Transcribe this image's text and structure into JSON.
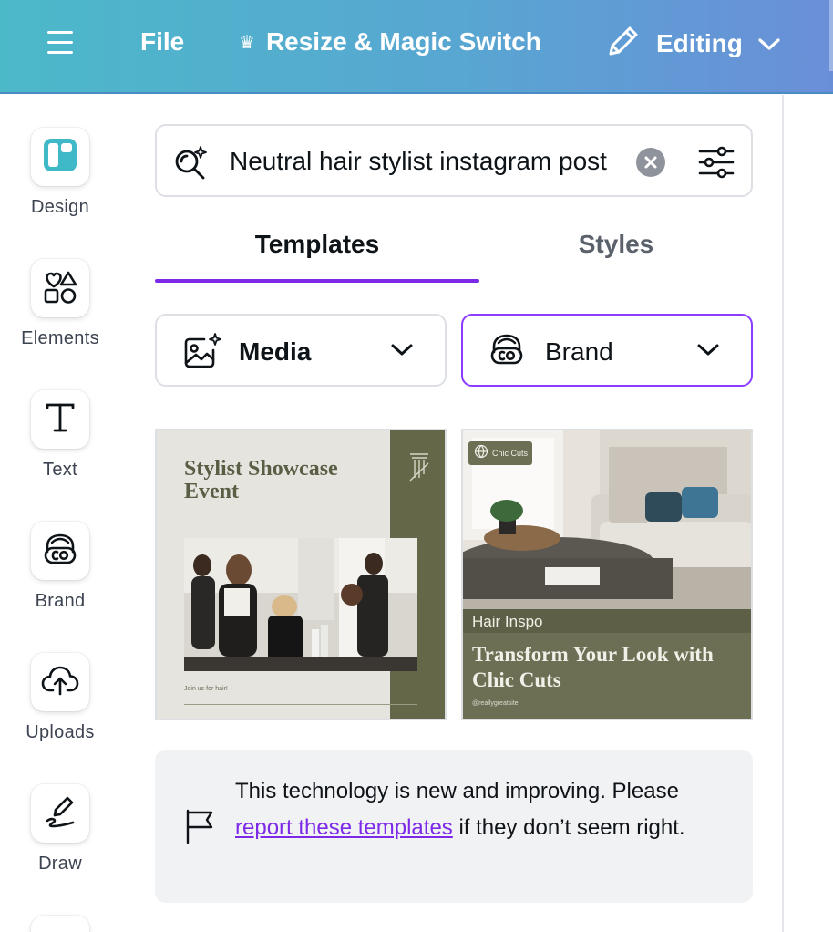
{
  "topbar": {
    "file_label": "File",
    "resize_label": "Resize & Magic Switch",
    "editing_label": "Editing"
  },
  "rail": {
    "items": [
      {
        "label": "Design",
        "icon": "design-icon"
      },
      {
        "label": "Elements",
        "icon": "elements-icon"
      },
      {
        "label": "Text",
        "icon": "text-icon"
      },
      {
        "label": "Brand",
        "icon": "brand-icon"
      },
      {
        "label": "Uploads",
        "icon": "upload-cloud-icon"
      },
      {
        "label": "Draw",
        "icon": "draw-icon"
      }
    ]
  },
  "search": {
    "value": "Neutral hair stylist instagram post"
  },
  "tabs": [
    {
      "label": "Templates",
      "active": true
    },
    {
      "label": "Styles",
      "active": false
    }
  ],
  "filters": {
    "media_label": "Media",
    "brand_label": "Brand"
  },
  "templates": [
    {
      "title": "Stylist Showcase Event",
      "caption": "Join us for hair!"
    },
    {
      "logo": "Chic Cuts",
      "tag": "Hair Inspo",
      "title": "Transform Your Look with Chic Cuts",
      "handle": "@reallygreatsite"
    }
  ],
  "notice": {
    "text_before": "This technology is new and improving. Please ",
    "link_label": "report these templates",
    "text_after": " if they don’t seem right."
  },
  "colors": {
    "accent": "#7d2ae8",
    "topbar_start": "#4cb9c9",
    "topbar_end": "#6a8fd8",
    "template_olive": "#656848"
  }
}
